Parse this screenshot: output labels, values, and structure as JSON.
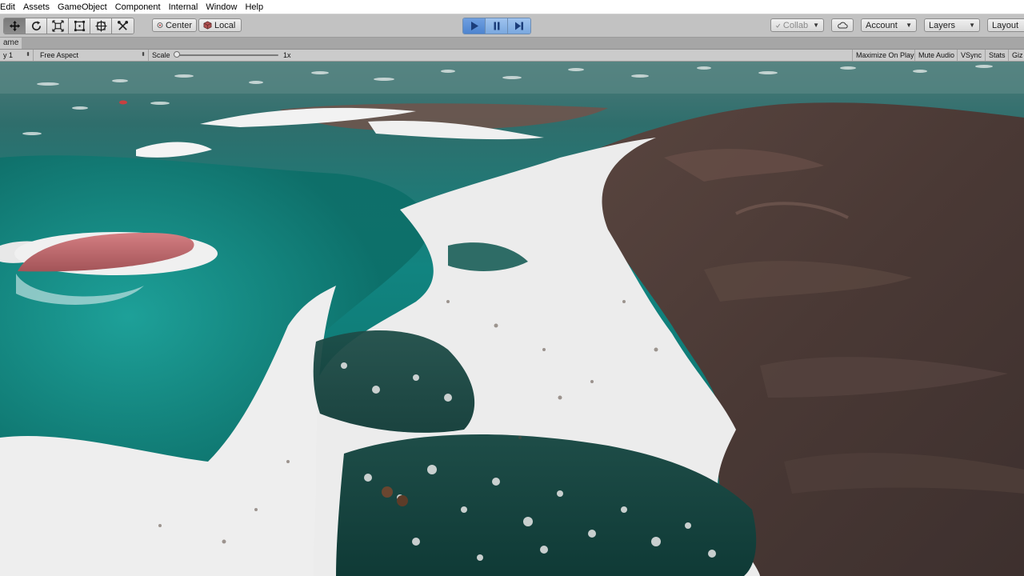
{
  "menu": {
    "items": [
      "Edit",
      "Assets",
      "GameObject",
      "Component",
      "Internal",
      "Window",
      "Help"
    ]
  },
  "toolbar": {
    "tools": [
      {
        "name": "hand-move-tool",
        "active": true
      },
      {
        "name": "rotate-tool",
        "active": false
      },
      {
        "name": "scale-tool",
        "active": false
      },
      {
        "name": "rect-tool",
        "active": false
      },
      {
        "name": "transform-tool",
        "active": false
      },
      {
        "name": "custom-tool",
        "active": false
      }
    ],
    "pivot_label": "Center",
    "space_label": "Local",
    "collab_label": "Collab",
    "account_label": "Account",
    "layers_label": "Layers",
    "layout_label": "Layout",
    "play_state": "playing"
  },
  "game_view": {
    "tab_label": "ame",
    "display_label": "y 1",
    "aspect_label": "Free Aspect",
    "scale_label": "Scale",
    "scale_value": "1x",
    "scale_fraction": 0,
    "maximize_label": "Maximize On Play",
    "mute_label": "Mute Audio",
    "vsync_label": "VSync",
    "stats_label": "Stats",
    "gizmos_label": "Giz"
  },
  "colors": {
    "play_accent": "#4d84cf",
    "water": "#0f6e6a",
    "foam": "#f1f1f1",
    "rock": "#4a3b36",
    "disc": "#c46c70"
  }
}
